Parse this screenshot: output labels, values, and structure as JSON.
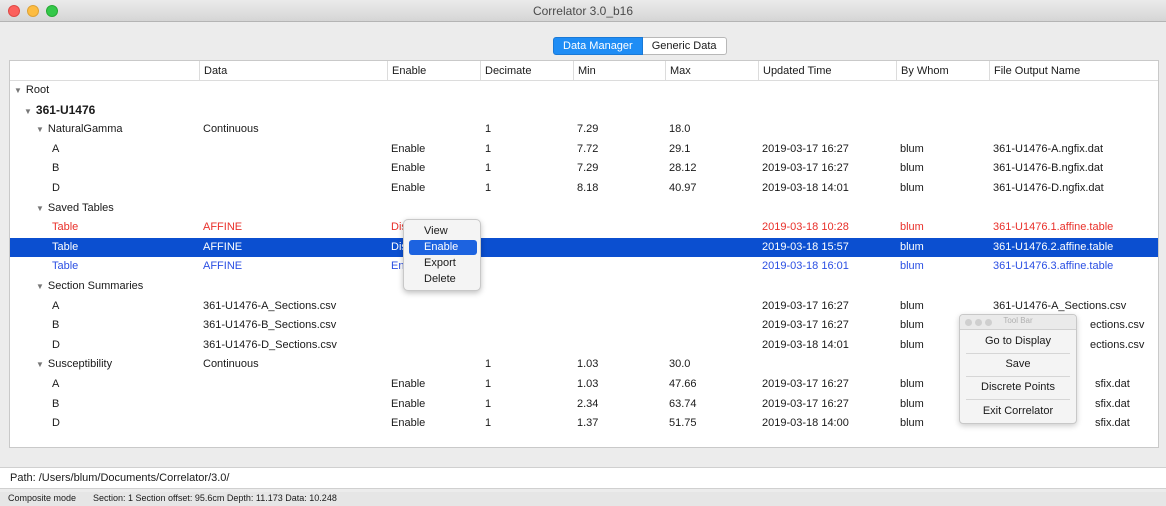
{
  "window": {
    "title": "Correlator 3.0_b16"
  },
  "tabs": {
    "data_manager": "Data Manager",
    "generic_data": "Generic Data"
  },
  "columns": [
    "Data",
    "Enable",
    "Decimate",
    "Min",
    "Max",
    "Updated Time",
    "By Whom",
    "File Output Name"
  ],
  "rows": [
    {
      "name": "Root",
      "data": "",
      "enable": "",
      "decimate": "",
      "min": "",
      "max": "",
      "updated": "",
      "by": "",
      "file": ""
    },
    {
      "name": "361-U1476",
      "data": "",
      "enable": "",
      "decimate": "",
      "min": "",
      "max": "",
      "updated": "",
      "by": "",
      "file": ""
    },
    {
      "name": "NaturalGamma",
      "data": "Continuous",
      "enable": "",
      "decimate": "1",
      "min": "7.29",
      "max": "18.0",
      "updated": "",
      "by": "",
      "file": ""
    },
    {
      "name": "A",
      "data": "",
      "enable": "Enable",
      "decimate": "1",
      "min": "7.72",
      "max": "29.1",
      "updated": "2019-03-17 16:27",
      "by": "blum",
      "file": "361-U1476-A.ngfix.dat"
    },
    {
      "name": "B",
      "data": "",
      "enable": "Enable",
      "decimate": "1",
      "min": "7.29",
      "max": "28.12",
      "updated": "2019-03-17 16:27",
      "by": "blum",
      "file": "361-U1476-B.ngfix.dat"
    },
    {
      "name": "D",
      "data": "",
      "enable": "Enable",
      "decimate": "1",
      "min": "8.18",
      "max": "40.97",
      "updated": "2019-03-18 14:01",
      "by": "blum",
      "file": "361-U1476-D.ngfix.dat"
    },
    {
      "name": "Saved Tables",
      "data": "",
      "enable": "",
      "decimate": "",
      "min": "",
      "max": "",
      "updated": "",
      "by": "",
      "file": ""
    },
    {
      "name": "Table",
      "data": "AFFINE",
      "enable": "Dis",
      "decimate": "",
      "min": "",
      "max": "",
      "updated": "2019-03-18 10:28",
      "by": "blum",
      "file": "361-U1476.1.affine.table"
    },
    {
      "name": "Table",
      "data": "AFFINE",
      "enable": "Dis",
      "decimate": "",
      "min": "",
      "max": "",
      "updated": "2019-03-18 15:57",
      "by": "blum",
      "file": "361-U1476.2.affine.table"
    },
    {
      "name": "Table",
      "data": "AFFINE",
      "enable": "En",
      "decimate": "",
      "min": "",
      "max": "",
      "updated": "2019-03-18 16:01",
      "by": "blum",
      "file": "361-U1476.3.affine.table"
    },
    {
      "name": "Section Summaries",
      "data": "",
      "enable": "",
      "decimate": "",
      "min": "",
      "max": "",
      "updated": "",
      "by": "",
      "file": ""
    },
    {
      "name": "A",
      "data": "361-U1476-A_Sections.csv",
      "enable": "",
      "decimate": "",
      "min": "",
      "max": "",
      "updated": "2019-03-17 16:27",
      "by": "blum",
      "file": "361-U1476-A_Sections.csv"
    },
    {
      "name": "B",
      "data": "361-U1476-B_Sections.csv",
      "enable": "",
      "decimate": "",
      "min": "",
      "max": "",
      "updated": "2019-03-17 16:27",
      "by": "blum",
      "file": "ections.csv"
    },
    {
      "name": "D",
      "data": "361-U1476-D_Sections.csv",
      "enable": "",
      "decimate": "",
      "min": "",
      "max": "",
      "updated": "2019-03-18 14:01",
      "by": "blum",
      "file": "ections.csv"
    },
    {
      "name": "Susceptibility",
      "data": "Continuous",
      "enable": "",
      "decimate": "1",
      "min": "1.03",
      "max": "30.0",
      "updated": "",
      "by": "",
      "file": ""
    },
    {
      "name": "A",
      "data": "",
      "enable": "Enable",
      "decimate": "1",
      "min": "1.03",
      "max": "47.66",
      "updated": "2019-03-17 16:27",
      "by": "blum",
      "file": "sfix.dat"
    },
    {
      "name": "B",
      "data": "",
      "enable": "Enable",
      "decimate": "1",
      "min": "2.34",
      "max": "63.74",
      "updated": "2019-03-17 16:27",
      "by": "blum",
      "file": "sfix.dat"
    },
    {
      "name": "D",
      "data": "",
      "enable": "Enable",
      "decimate": "1",
      "min": "1.37",
      "max": "51.75",
      "updated": "2019-03-18 14:00",
      "by": "blum",
      "file": "sfix.dat"
    }
  ],
  "context_menu": {
    "items": [
      "View",
      "Enable",
      "Export",
      "Delete"
    ],
    "highlighted": "Enable"
  },
  "toolbar": {
    "title": "Tool Bar",
    "buttons": [
      "Go to Display",
      "Save",
      "Discrete Points",
      "Exit Correlator"
    ]
  },
  "path": "Path: /Users/blum/Documents/Correlator/3.0/",
  "status": {
    "mode": "Composite mode",
    "info": "Section: 1 Section offset: 95.6cm Depth: 11.173 Data: 10.248"
  },
  "colors": {
    "selection": "#0b4fd0",
    "red_row": "#e8302a",
    "blue_row": "#2b4fe3",
    "tab_active": "#1f8df5"
  }
}
